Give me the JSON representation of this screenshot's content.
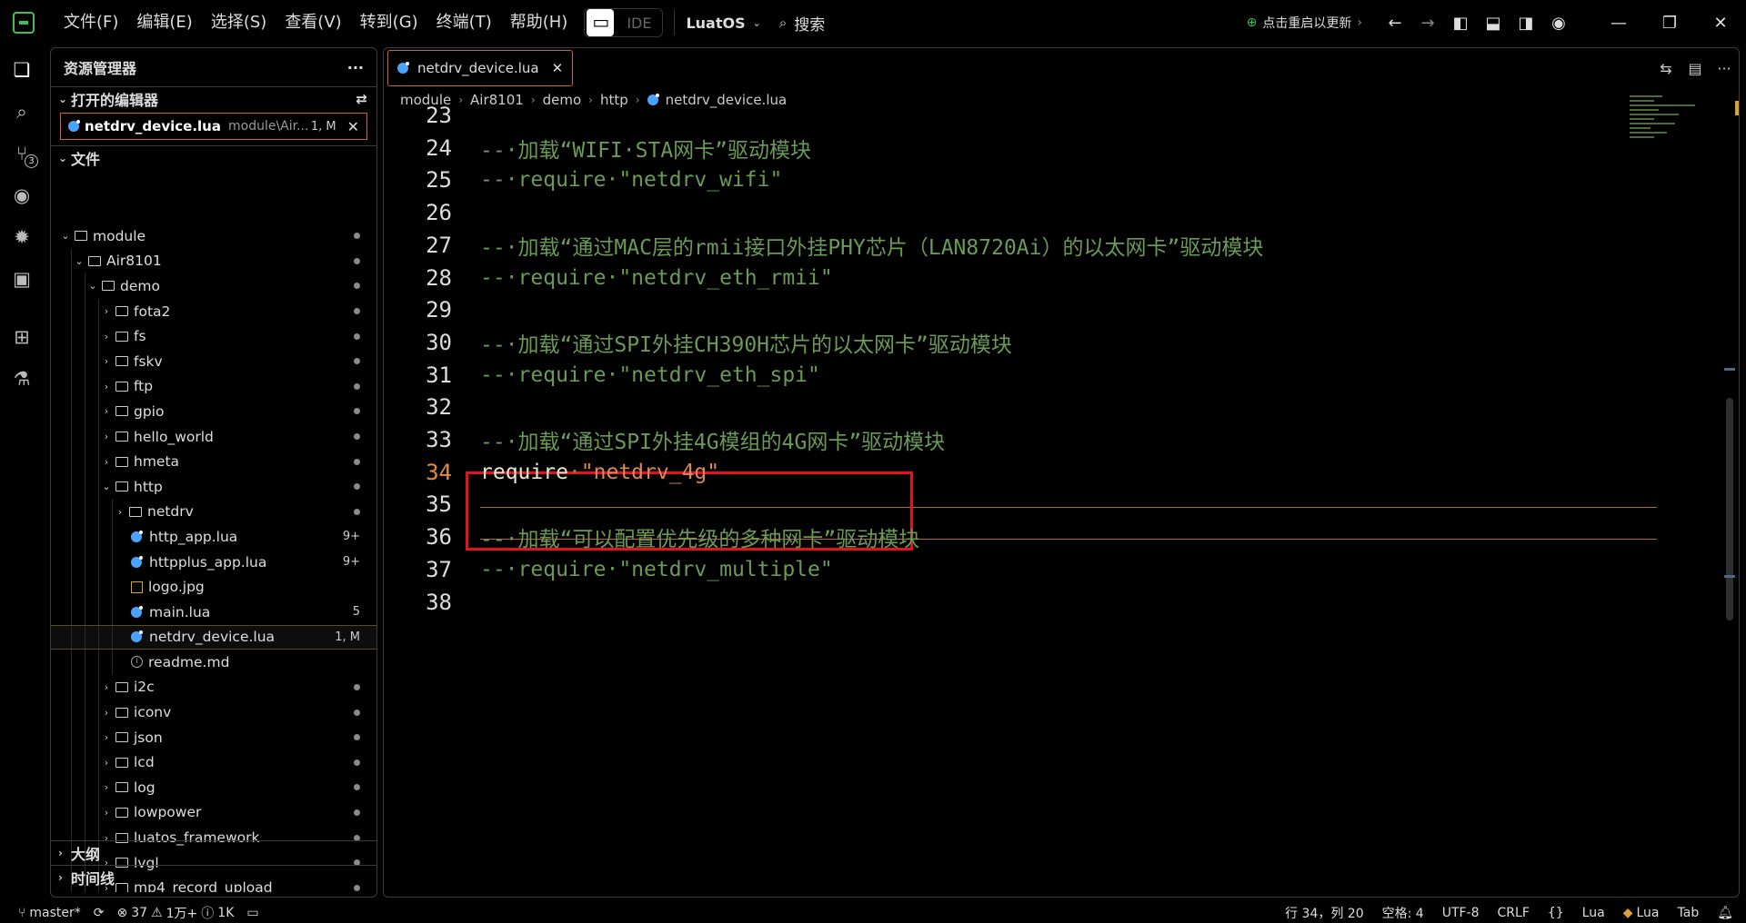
{
  "menu": [
    "文件(F)",
    "编辑(E)",
    "选择(S)",
    "查看(V)",
    "转到(G)",
    "终端(T)",
    "帮助(H)"
  ],
  "ide_label": "IDE",
  "project": "LuatOS",
  "search_label": "搜索",
  "update_label": "点击重启以更新",
  "activity_badge": "3",
  "sidebar": {
    "title": "资源管理器",
    "more": "···",
    "open_editors_title": "打开的编辑器",
    "open_editor": {
      "name": "netdrv_device.lua",
      "path": "module\\Air...",
      "badge": "1, M",
      "close": "✕"
    },
    "files_title": "文件",
    "tree": [
      {
        "label": "module",
        "depth": 0,
        "kind": "folder-open",
        "dot": true
      },
      {
        "label": "Air8101",
        "depth": 1,
        "kind": "folder-open",
        "dot": true
      },
      {
        "label": "demo",
        "depth": 2,
        "kind": "folder-open",
        "dot": true
      },
      {
        "label": "fota2",
        "depth": 3,
        "kind": "folder",
        "dot": true
      },
      {
        "label": "fs",
        "depth": 3,
        "kind": "folder",
        "dot": true
      },
      {
        "label": "fskv",
        "depth": 3,
        "kind": "folder",
        "dot": true
      },
      {
        "label": "ftp",
        "depth": 3,
        "kind": "folder",
        "dot": true
      },
      {
        "label": "gpio",
        "depth": 3,
        "kind": "folder",
        "dot": true
      },
      {
        "label": "hello_world",
        "depth": 3,
        "kind": "folder",
        "dot": true
      },
      {
        "label": "hmeta",
        "depth": 3,
        "kind": "folder",
        "dot": true
      },
      {
        "label": "http",
        "depth": 3,
        "kind": "folder-open",
        "dot": true
      },
      {
        "label": "netdrv",
        "depth": 4,
        "kind": "folder",
        "dot": true
      },
      {
        "label": "http_app.lua",
        "depth": 4,
        "kind": "lua",
        "badge": "9+"
      },
      {
        "label": "httpplus_app.lua",
        "depth": 4,
        "kind": "lua",
        "badge": "9+"
      },
      {
        "label": "logo.jpg",
        "depth": 4,
        "kind": "image"
      },
      {
        "label": "main.lua",
        "depth": 4,
        "kind": "lua",
        "badge": "5"
      },
      {
        "label": "netdrv_device.lua",
        "depth": 4,
        "kind": "lua",
        "badge": "1, M",
        "selected": true
      },
      {
        "label": "readme.md",
        "depth": 4,
        "kind": "info"
      },
      {
        "label": "i2c",
        "depth": 3,
        "kind": "folder",
        "dot": true
      },
      {
        "label": "iconv",
        "depth": 3,
        "kind": "folder",
        "dot": true
      },
      {
        "label": "json",
        "depth": 3,
        "kind": "folder",
        "dot": true
      },
      {
        "label": "lcd",
        "depth": 3,
        "kind": "folder",
        "dot": true
      },
      {
        "label": "log",
        "depth": 3,
        "kind": "folder",
        "dot": true
      },
      {
        "label": "lowpower",
        "depth": 3,
        "kind": "folder",
        "dot": true
      },
      {
        "label": "luatos_framework",
        "depth": 3,
        "kind": "folder",
        "dot": true
      },
      {
        "label": "lvgl",
        "depth": 3,
        "kind": "folder",
        "dot": true
      },
      {
        "label": "mp4_record_upload",
        "depth": 3,
        "kind": "folder",
        "dot": true
      }
    ],
    "outline_title": "大纲",
    "timeline_title": "时间线"
  },
  "editor": {
    "tab": {
      "name": "netdrv_device.lua",
      "close": "✕"
    },
    "breadcrumb": [
      "module",
      "Air8101",
      "demo",
      "http",
      "netdrv_device.lua"
    ],
    "lines": [
      {
        "n": "23",
        "text": "",
        "cls": ""
      },
      {
        "n": "24",
        "text": "--·加载“WIFI·STA网卡”驱动模块",
        "cls": "comment"
      },
      {
        "n": "25",
        "text": "--·require·\"netdrv_wifi\"",
        "cls": "comment"
      },
      {
        "n": "26",
        "text": "",
        "cls": ""
      },
      {
        "n": "27",
        "text": "--·加载“通过MAC层的rmii接口外挂PHY芯片（LAN8720Ai）的以太网卡”驱动模块",
        "cls": "comment"
      },
      {
        "n": "28",
        "text": "--·require·\"netdrv_eth_rmii\"",
        "cls": "comment"
      },
      {
        "n": "29",
        "text": "",
        "cls": ""
      },
      {
        "n": "30",
        "text": "--·加载“通过SPI外挂CH390H芯片的以太网卡”驱动模块",
        "cls": "comment"
      },
      {
        "n": "31",
        "text": "--·require·\"netdrv_eth_spi\"",
        "cls": "comment"
      },
      {
        "n": "32",
        "text": "",
        "cls": ""
      },
      {
        "n": "33",
        "text": "--·加载“通过SPI外挂4G模组的4G网卡”驱动模块",
        "cls": "comment"
      },
      {
        "n": "34",
        "text": "",
        "cls": "active",
        "kw": "require",
        "dot": "·",
        "str": "\"netdrv_4g\""
      },
      {
        "n": "35",
        "text": "",
        "cls": ""
      },
      {
        "n": "36",
        "text": "--·加载“可以配置优先级的多种网卡”驱动模块",
        "cls": "comment"
      },
      {
        "n": "37",
        "text": "--·require·\"netdrv_multiple\"",
        "cls": "comment"
      },
      {
        "n": "38",
        "text": "",
        "cls": ""
      }
    ]
  },
  "status": {
    "branch": "master*",
    "errors": "37",
    "warnings": "1万+",
    "infos": "1K",
    "position": "行 34，列 20",
    "spaces": "空格: 4",
    "encoding": "UTF-8",
    "eol": "CRLF",
    "braces": "{}",
    "lang1": "Lua",
    "lang2": "Lua",
    "tab": "Tab"
  },
  "colors": {
    "accent": "#c6662d",
    "highlight": "#e0141e",
    "comment": "#6a9a55",
    "string": "#d98a5a",
    "lua": "#4aa3ff"
  }
}
